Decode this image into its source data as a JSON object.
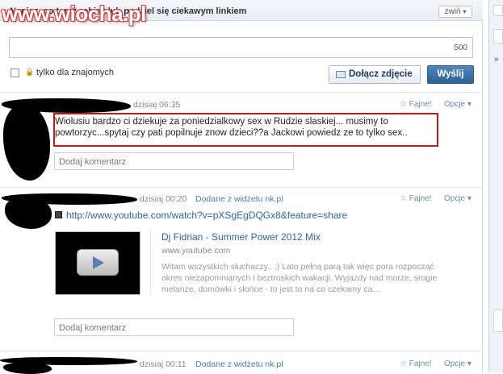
{
  "watermark": "www.wiocha.pl",
  "composer": {
    "title": "Napisz, co teraz robisz lub podziel się ciekawym linkiem",
    "toggle_label": "zwiń",
    "char_count": "500",
    "privacy_label": "tylko dla znajomych",
    "attach_photo_label": "Dołącz zdjęcie",
    "send_label": "Wyślij"
  },
  "posts": [
    {
      "time": "dzisiaj 06:35",
      "source": "",
      "like_label": "Fajne!",
      "options_label": "Opcje",
      "text": "Wiolusiu bardzo ci dziekuje za poniedzialkowy sex w Rudzie slaskiej... musimy to powtorzyc...spytaj czy pati popilnuje znow dzieci??a Jackowi powiedz ze to tylko sex..",
      "comment_placeholder": "Dodaj komentarz"
    },
    {
      "time": "dzisiaj 00:20",
      "source": "Dodane z widżetu nk.pl",
      "like_label": "Fajne!",
      "options_label": "Opcje",
      "link_url": "http://www.youtube.com/watch?v=pXSgEgDQGx8&feature=share",
      "video_title": "Dj Fidrian - Summer Power 2012 Mix",
      "video_site": "www.youtube.com",
      "video_description": "Witam wszystkich słuchaczy.. ;) Lato pełną parą tak więc pora rozpocząć okres niezapomnianych i beztroskich wakacji. Wyjazdy nad morze, srogie melanże, domówki i słońce - to jest to na co czekamy ca...",
      "comment_placeholder": "Dodaj komentarz"
    },
    {
      "time": "dzisiaj 00:11",
      "source": "Dodane z widżetu nk.pl",
      "like_label": "Fajne!",
      "options_label": "Opcje"
    }
  ],
  "icons": {
    "collapse": "chevron-icon",
    "lock": "lock-icon",
    "photo": "photo-icon",
    "star": "star-icon",
    "options": "chevron-down-icon",
    "link": "link-icon",
    "play": "play-icon"
  },
  "colors": {
    "accent": "#2d6198",
    "link": "#2b65a8",
    "highlight": "#c21a1a"
  }
}
